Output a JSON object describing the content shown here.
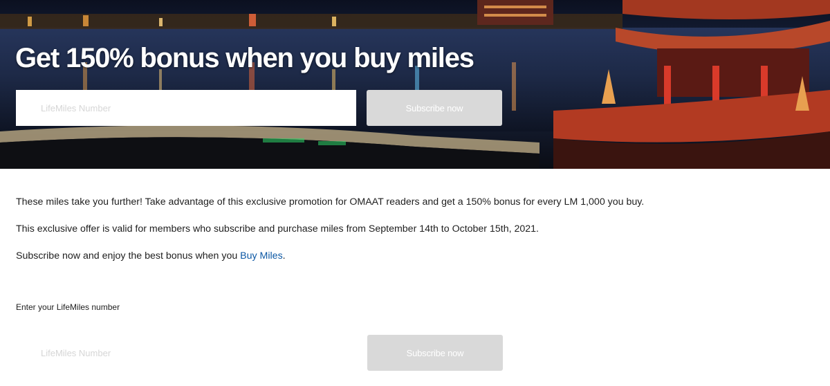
{
  "hero": {
    "title": "Get 150% bonus when you buy miles",
    "input_placeholder": "LifeMiles Number",
    "button_label": "Subscribe now"
  },
  "content": {
    "paragraph1": "These miles take you further! Take advantage of this exclusive promotion for OMAAT readers and get a 150% bonus for every LM 1,000 you buy.",
    "paragraph2": "This exclusive offer is valid for members who subscribe and purchase miles from September 14th to October 15th, 2021.",
    "paragraph3_prefix": "Subscribe now and enjoy the best bonus when you ",
    "paragraph3_link": "Buy Miles",
    "paragraph3_suffix": "."
  },
  "form": {
    "label": "Enter your LifeMiles number",
    "input_placeholder": "LifeMiles Number",
    "button_label": "Subscribe now"
  },
  "colors": {
    "link": "#0b57a4",
    "button_bg": "#d9d9d9",
    "text": "#1e1e1e"
  }
}
